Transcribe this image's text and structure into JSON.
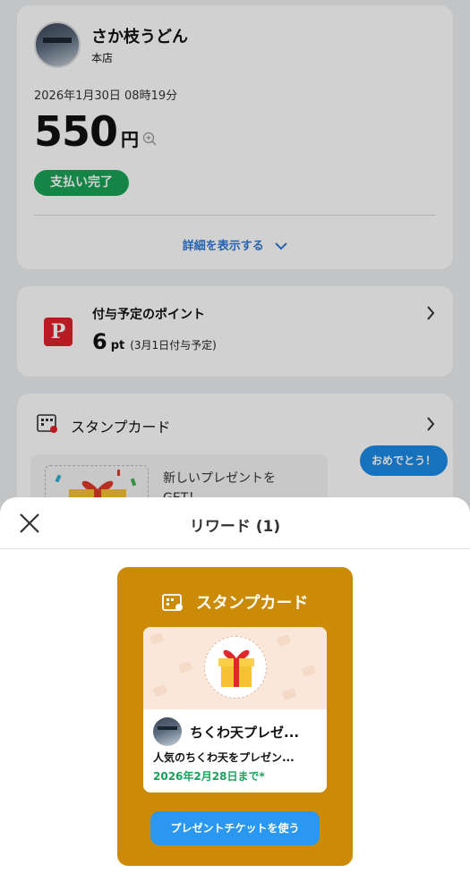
{
  "store": {
    "name": "さか枝うどん",
    "branch": "本店",
    "datetime": "2026年1月30日 08時19分",
    "amount": "550",
    "currency": "円",
    "status": "支払い完了",
    "details_link": "詳細を表示する"
  },
  "points": {
    "title": "付与予定のポイント",
    "value": "6",
    "unit": "pt",
    "note": "(3月1日付与予定)",
    "logo_text": "P"
  },
  "stamp_card": {
    "title": "スタンプカード",
    "present_text_line1": "新しいプレゼントを",
    "present_text_line2": "GET！",
    "bubble": "おめでとう！"
  },
  "sheet": {
    "title": "リワード (1)",
    "card_title": "スタンプカード",
    "ticket_name": "ちくわ天プレゼ...",
    "ticket_desc": "人気のちくわ天をプレゼン...",
    "ticket_expiry": "2026年2月28日まで*",
    "use_button": "プレゼントチケットを使う"
  },
  "colors": {
    "accent_green": "#1aa356",
    "link_blue": "#2f79d6",
    "button_blue": "#2a97f0",
    "card_gold": "#cb8b07",
    "paypay_red": "#e1212c"
  },
  "icons": [
    "zoom-in-icon",
    "chevron-down-icon",
    "chevron-right-icon",
    "stamp-card-icon",
    "close-icon",
    "gift-icon"
  ]
}
